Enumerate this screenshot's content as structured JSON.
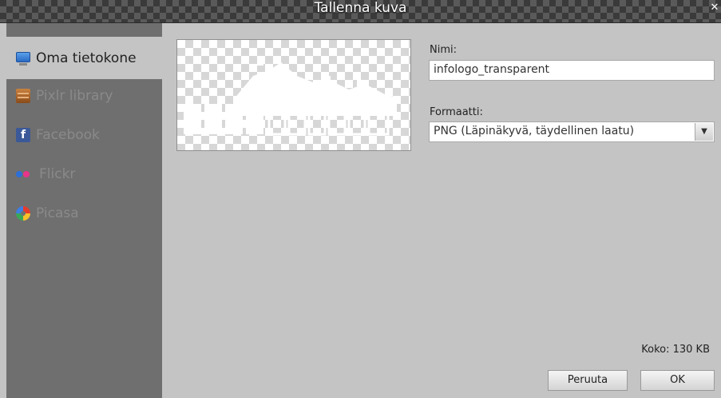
{
  "window": {
    "title": "Tallenna kuva",
    "close_symbol": "✕"
  },
  "sidebar": {
    "items": [
      {
        "label": "Oma tietokone",
        "icon": "computer-icon",
        "active": true
      },
      {
        "label": "Pixlr library",
        "icon": "library-icon",
        "active": false
      },
      {
        "label": "Facebook",
        "icon": "facebook-icon",
        "active": false
      },
      {
        "label": "Flickr",
        "icon": "flickr-icon",
        "active": false
      },
      {
        "label": "Picasa",
        "icon": "picasa-icon",
        "active": false
      }
    ]
  },
  "form": {
    "name_label": "Nimi:",
    "name_value": "infologo_transparent",
    "format_label": "Formaatti:",
    "format_value": "PNG (Läpinäkyvä, täydellinen laatu)"
  },
  "file_size": "Koko: 130 KB",
  "buttons": {
    "cancel": "Peruuta",
    "ok": "OK"
  },
  "colors": {
    "sidebar_bg": "#6f6f6f",
    "panel_bg": "#c4c4c4",
    "facebook": "#3b5998"
  }
}
